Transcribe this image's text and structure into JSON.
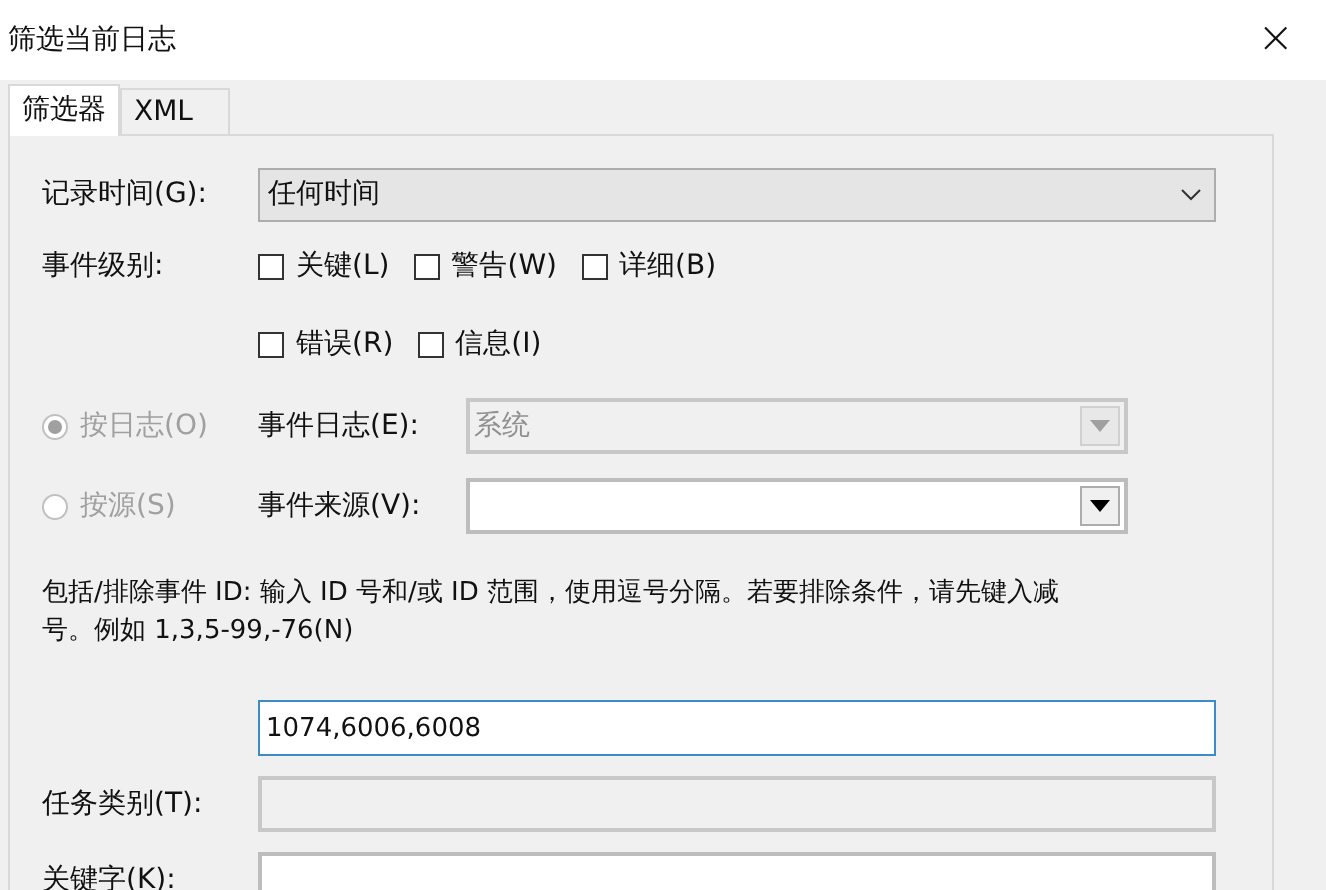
{
  "window": {
    "title": "筛选当前日志",
    "close": "×"
  },
  "tabs": [
    {
      "label": "筛选器",
      "selected": true
    },
    {
      "label": "XML",
      "selected": false
    }
  ],
  "logged": {
    "label": "记录时间(G):",
    "value": "任何时间"
  },
  "event_level": {
    "label": "事件级别:",
    "options": [
      {
        "label": "关键(L)",
        "checked": false
      },
      {
        "label": "警告(W)",
        "checked": false
      },
      {
        "label": "详细(B)",
        "checked": false
      },
      {
        "label": "错误(R)",
        "checked": false
      },
      {
        "label": "信息(I)",
        "checked": false
      }
    ]
  },
  "sources": [
    {
      "radio": "按日志(O)",
      "selected": true,
      "disabled": true,
      "label": "事件日志(E):",
      "value": "系统",
      "field_disabled": true
    },
    {
      "radio": "按源(S)",
      "selected": false,
      "disabled": true,
      "label": "事件来源(V):",
      "field_disabled": false
    }
  ],
  "event_ids": {
    "description": "包括/排除事件 ID: 输入 ID 号和/或 ID 范围，使用逗号分隔。若要排除条件，请先键入减号。例如 1,3,5-99,-76(N)",
    "value": "1074,6006,6008"
  },
  "fields": [
    {
      "label": "任务类别(T):",
      "disabled": true
    },
    {
      "label": "关键字(K):",
      "disabled": false
    }
  ]
}
